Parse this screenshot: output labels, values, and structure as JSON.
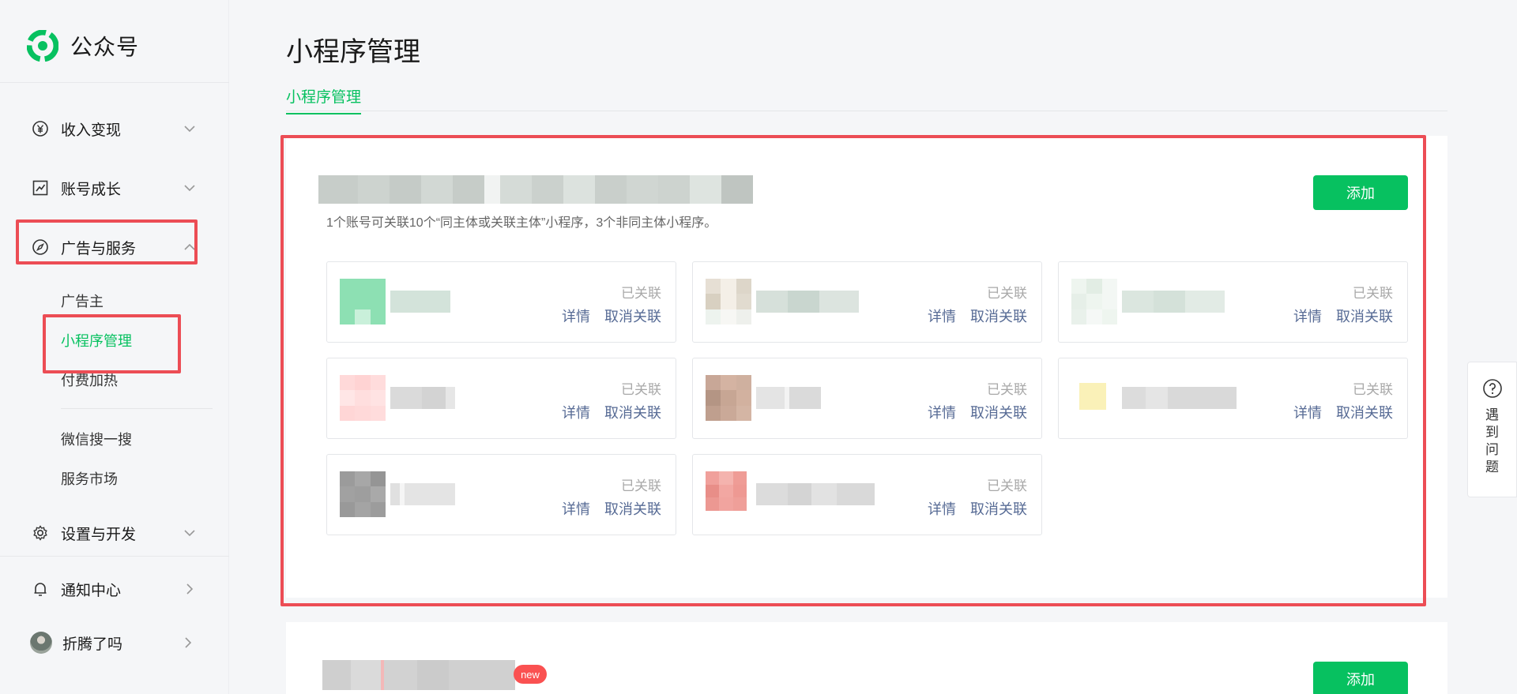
{
  "app": {
    "logo_text": "公众号"
  },
  "sidebar": {
    "menu": [
      {
        "label": "收入变现",
        "icon": "yuan-circle-icon"
      },
      {
        "label": "账号成长",
        "icon": "trend-chart-icon"
      },
      {
        "label": "广告与服务",
        "icon": "compass-icon"
      },
      {
        "label": "设置与开发",
        "icon": "gear-icon"
      },
      {
        "label": "通知中心",
        "icon": "bell-icon"
      },
      {
        "label": "折腾了吗",
        "icon": "avatar"
      }
    ],
    "sub_items": [
      {
        "label": "广告主"
      },
      {
        "label": "小程序管理"
      },
      {
        "label": "付费加热"
      },
      {
        "label": "微信搜一搜"
      },
      {
        "label": "服务市场"
      }
    ]
  },
  "main": {
    "page_title": "小程序管理",
    "tab_label": "小程序管理",
    "section1": {
      "hint": "1个账号可关联10个“同主体或关联主体”小程序，3个非同主体小程序。",
      "add_label": "添加"
    },
    "section2": {
      "badge": "new",
      "add_label": "添加"
    },
    "card_status": "已关联",
    "card_detail": "详情",
    "card_unlink": "取消关联",
    "card_count": 8
  },
  "help": {
    "label": "遇到问题"
  },
  "colors": {
    "accent": "#07c160",
    "link": "#576b95",
    "highlight": "#ec4d55",
    "badge": "#fa5151"
  }
}
